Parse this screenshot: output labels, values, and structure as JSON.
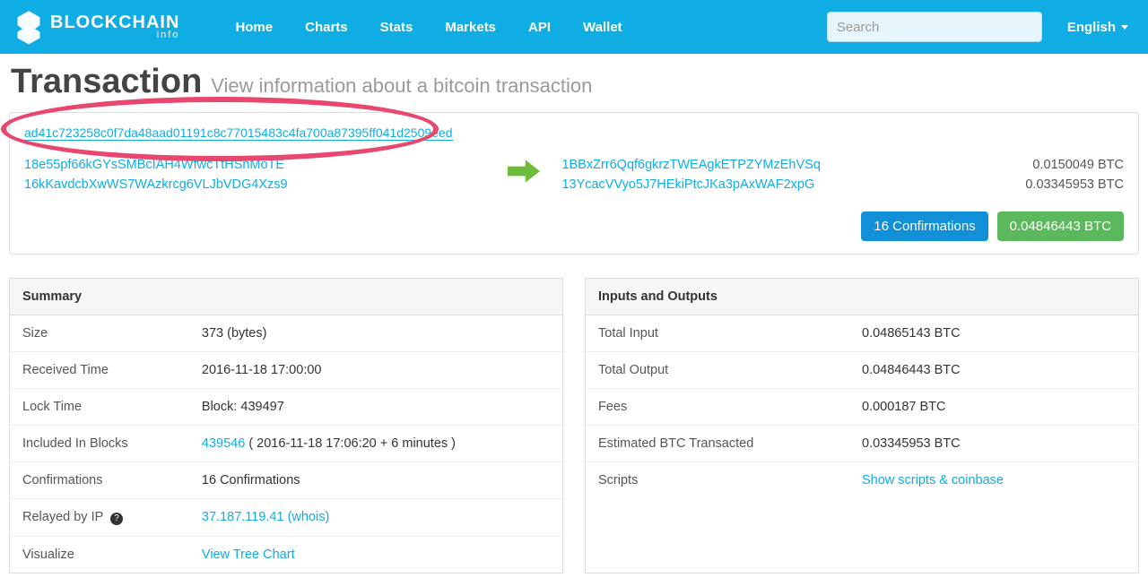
{
  "brand": {
    "name": "BLOCKCHAIN",
    "sub": "info"
  },
  "nav": {
    "home": "Home",
    "charts": "Charts",
    "stats": "Stats",
    "markets": "Markets",
    "api": "API",
    "wallet": "Wallet"
  },
  "search": {
    "placeholder": "Search"
  },
  "language": {
    "label": "English"
  },
  "page": {
    "title": "Transaction",
    "subtitle": "View information about a bitcoin transaction"
  },
  "tx": {
    "hash": "ad41c723258c0f7da48aad01191c8c77015483c4fa700a87395ff041d2509eed",
    "inputs": [
      "18e55pf66kGYsSMBcIAH4WfwcTtHSnMoTE",
      "16kKavdcbXwWS7WAzkrcg6VLJbVDG4Xzs9"
    ],
    "outputs": [
      {
        "addr": "1BBxZrr6Qqf6gkrzTWEAgkETPZYMzEhVSq",
        "amount": "0.0150049 BTC"
      },
      {
        "addr": "13YcacVVyo5J7HEkiPtcJKa3pAxWAF2xpG",
        "amount": "0.03345953 BTC"
      }
    ],
    "confirmations_badge": "16 Confirmations",
    "total_badge": "0.04846443 BTC"
  },
  "summary": {
    "title": "Summary",
    "rows": {
      "size_label": "Size",
      "size_value": "373 (bytes)",
      "received_label": "Received Time",
      "received_value": "2016-11-18 17:00:00",
      "lock_label": "Lock Time",
      "lock_value": "Block: 439497",
      "included_label": "Included In Blocks",
      "included_link": "439546",
      "included_suffix": " ( 2016-11-18 17:06:20 + 6 minutes )",
      "conf_label": "Confirmations",
      "conf_value": "16 Confirmations",
      "relay_label": "Relayed by IP",
      "relay_ip": "37.187.119.41",
      "relay_whois": " (whois)",
      "viz_label": "Visualize",
      "viz_link": "View Tree Chart"
    }
  },
  "io": {
    "title": "Inputs and Outputs",
    "rows": {
      "tin_label": "Total Input",
      "tin_value": "0.04865143 BTC",
      "tout_label": "Total Output",
      "tout_value": "0.04846443 BTC",
      "fees_label": "Fees",
      "fees_value": "0.000187 BTC",
      "est_label": "Estimated BTC Transacted",
      "est_value": "0.03345953 BTC",
      "scripts_label": "Scripts",
      "scripts_link": "Show scripts & coinbase"
    }
  }
}
